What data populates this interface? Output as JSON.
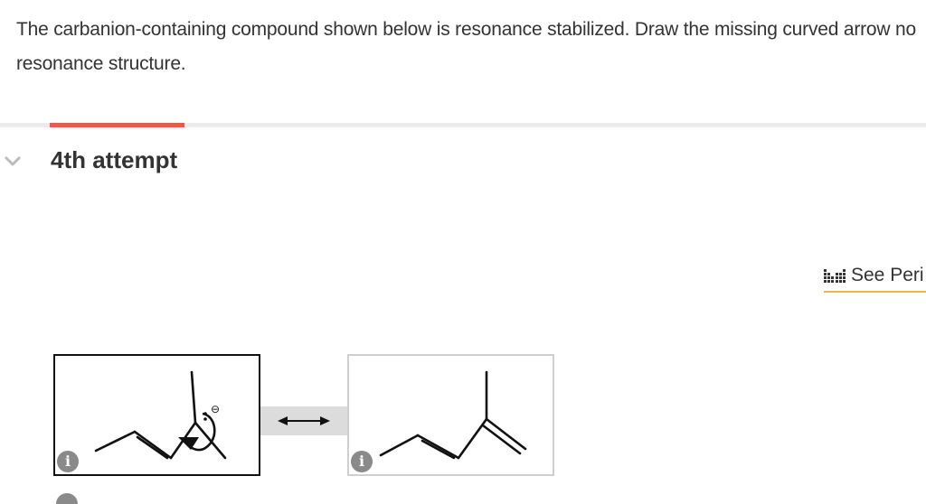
{
  "question": {
    "line1": "The carbanion-containing compound shown below is resonance stabilized. Draw the missing curved arrow no",
    "line2": "resonance structure."
  },
  "attempt": {
    "title": "4th attempt",
    "chevron_icon": "chevron-down-icon"
  },
  "periodic_table": {
    "label": "See Peri",
    "icon": "periodic-table-icon"
  },
  "structures": {
    "left": {
      "charge_label": "⊖",
      "info_icon": "info-icon",
      "info_text": "i"
    },
    "right": {
      "info_icon": "info-icon",
      "info_text": "i"
    },
    "resonance_arrow_icon": "double-headed-arrow-icon"
  },
  "colors": {
    "accent_red": "#e35d4d",
    "link_underline": "#e8b94a",
    "info_gray": "#8a8a8a",
    "chevron_gray": "#bbbbbb"
  }
}
